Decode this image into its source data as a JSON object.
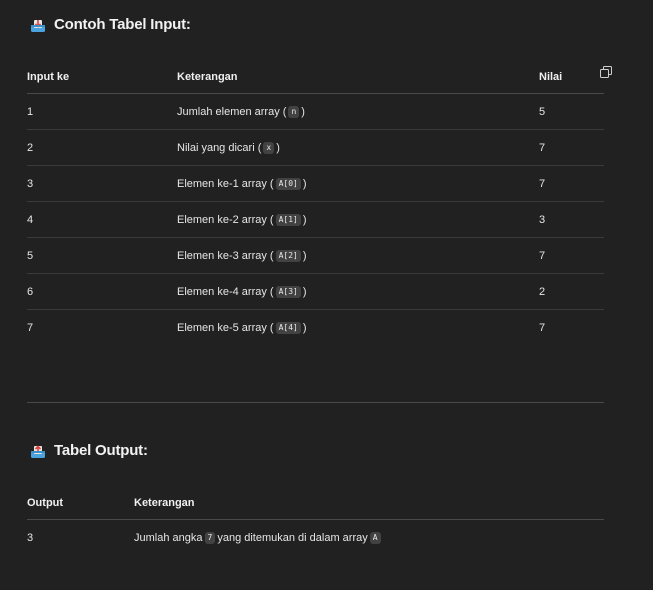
{
  "input_section": {
    "title": "Contoh Tabel Input:",
    "icon": "inbox-tray-icon",
    "headers": {
      "col1": "Input ke",
      "col2": "Keterangan",
      "col3": "Nilai"
    },
    "rows": [
      {
        "no": "1",
        "desc": "Jumlah elemen array (",
        "code": "n",
        "tail": ")",
        "value": "5"
      },
      {
        "no": "2",
        "desc": "Nilai yang dicari (",
        "code": "x",
        "tail": ")",
        "value": "7"
      },
      {
        "no": "3",
        "desc": "Elemen ke-1 array (",
        "code": "A[0]",
        "tail": ")",
        "value": "7"
      },
      {
        "no": "4",
        "desc": "Elemen ke-2 array (",
        "code": "A[1]",
        "tail": ")",
        "value": "3"
      },
      {
        "no": "5",
        "desc": "Elemen ke-3 array (",
        "code": "A[2]",
        "tail": ")",
        "value": "7"
      },
      {
        "no": "6",
        "desc": "Elemen ke-4 array (",
        "code": "A[3]",
        "tail": ")",
        "value": "2"
      },
      {
        "no": "7",
        "desc": "Elemen ke-5 array (",
        "code": "A[4]",
        "tail": ")",
        "value": "7"
      }
    ]
  },
  "output_section": {
    "title": "Tabel Output:",
    "icon": "outbox-tray-icon",
    "headers": {
      "col1": "Output",
      "col2": "Keterangan"
    },
    "rows": [
      {
        "value": "3",
        "desc_pre": "Jumlah angka",
        "code1": "7",
        "desc_mid": "yang ditemukan di dalam array",
        "code2": "A"
      }
    ]
  },
  "colors": {
    "background": "#212121",
    "text": "#ececec",
    "code_bg": "#424242",
    "border": "#3a3a3a"
  }
}
